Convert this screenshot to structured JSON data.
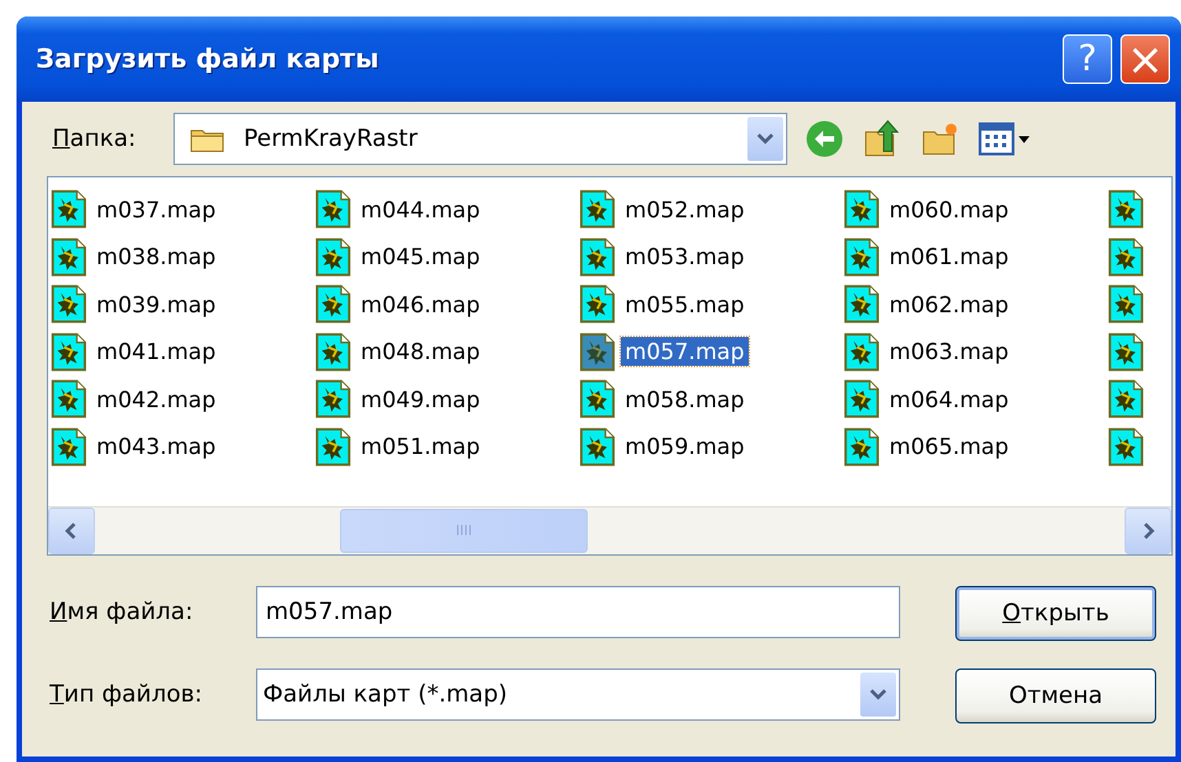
{
  "window": {
    "title": "Загрузить файл карты",
    "help": "?",
    "close": "×"
  },
  "folder": {
    "label": "Папка:",
    "accel": true,
    "value": "PermKrayRastr"
  },
  "files": [
    {
      "kind": "file",
      "name": "m037.map",
      "selected": false
    },
    {
      "kind": "file",
      "name": "m038.map",
      "selected": false
    },
    {
      "kind": "file",
      "name": "m039.map",
      "selected": false
    },
    {
      "kind": "file",
      "name": "m041.map",
      "selected": false
    },
    {
      "kind": "file",
      "name": "m042.map",
      "selected": false
    },
    {
      "kind": "file",
      "name": "m043.map",
      "selected": false
    },
    {
      "kind": "file",
      "name": "m044.map",
      "selected": false
    },
    {
      "kind": "file",
      "name": "m045.map",
      "selected": false
    },
    {
      "kind": "file",
      "name": "m046.map",
      "selected": false
    },
    {
      "kind": "file",
      "name": "m048.map",
      "selected": false
    },
    {
      "kind": "file",
      "name": "m049.map",
      "selected": false
    },
    {
      "kind": "file",
      "name": "m051.map",
      "selected": false
    },
    {
      "kind": "file",
      "name": "m052.map",
      "selected": false
    },
    {
      "kind": "file",
      "name": "m053.map",
      "selected": false
    },
    {
      "kind": "file",
      "name": "m055.map",
      "selected": false
    },
    {
      "kind": "file",
      "name": "m057.map",
      "selected": true
    },
    {
      "kind": "file",
      "name": "m058.map",
      "selected": false
    },
    {
      "kind": "file",
      "name": "m059.map",
      "selected": false
    },
    {
      "kind": "file",
      "name": "m060.map",
      "selected": false
    },
    {
      "kind": "file",
      "name": "m061.map",
      "selected": false
    },
    {
      "kind": "file",
      "name": "m062.map",
      "selected": false
    },
    {
      "kind": "file",
      "name": "m063.map",
      "selected": false
    },
    {
      "kind": "file",
      "name": "m064.map",
      "selected": false
    },
    {
      "kind": "file",
      "name": "m065.map",
      "selected": false
    },
    {
      "kind": "cut"
    },
    {
      "kind": "cut"
    },
    {
      "kind": "cut"
    },
    {
      "kind": "cut"
    },
    {
      "kind": "cut"
    },
    {
      "kind": "cut"
    }
  ],
  "scrollbar_text": "IIII",
  "filename": {
    "label": "Имя файла:",
    "accel": true,
    "value": "m057.map"
  },
  "filetype": {
    "label": "Тип файлов:",
    "accel": true,
    "value": "Файлы карт (*.map)"
  },
  "buttons": [
    {
      "label": "Открыть",
      "accel": true,
      "default": true
    },
    {
      "label": "Отмена",
      "accel": false,
      "default": false
    }
  ]
}
